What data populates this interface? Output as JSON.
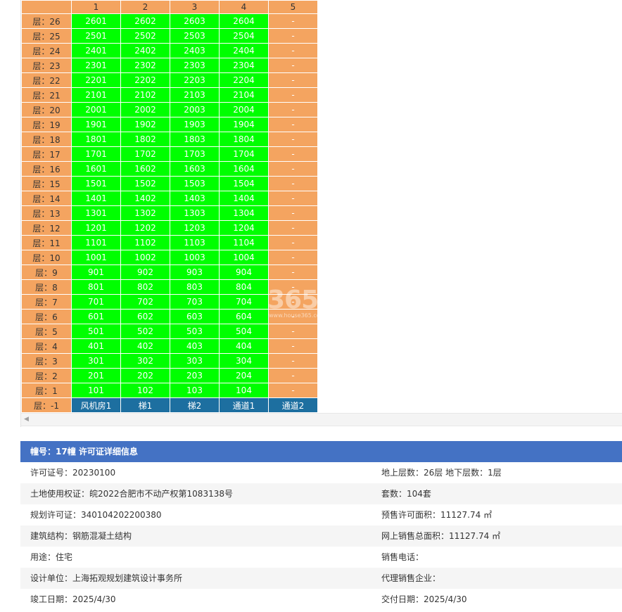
{
  "grid": {
    "columns": [
      "",
      "1",
      "2",
      "3",
      "4",
      "5"
    ],
    "rows": [
      {
        "floor": "层：26",
        "units": [
          "2601",
          "2602",
          "2603",
          "2604"
        ],
        "extra": "-"
      },
      {
        "floor": "层：25",
        "units": [
          "2501",
          "2502",
          "2503",
          "2504"
        ],
        "extra": "-"
      },
      {
        "floor": "层：24",
        "units": [
          "2401",
          "2402",
          "2403",
          "2404"
        ],
        "extra": "-"
      },
      {
        "floor": "层：23",
        "units": [
          "2301",
          "2302",
          "2303",
          "2304"
        ],
        "extra": "-"
      },
      {
        "floor": "层：22",
        "units": [
          "2201",
          "2202",
          "2203",
          "2204"
        ],
        "extra": "-"
      },
      {
        "floor": "层：21",
        "units": [
          "2101",
          "2102",
          "2103",
          "2104"
        ],
        "extra": "-"
      },
      {
        "floor": "层：20",
        "units": [
          "2001",
          "2002",
          "2003",
          "2004"
        ],
        "extra": "-"
      },
      {
        "floor": "层：19",
        "units": [
          "1901",
          "1902",
          "1903",
          "1904"
        ],
        "extra": "-"
      },
      {
        "floor": "层：18",
        "units": [
          "1801",
          "1802",
          "1803",
          "1804"
        ],
        "extra": "-"
      },
      {
        "floor": "层：17",
        "units": [
          "1701",
          "1702",
          "1703",
          "1704"
        ],
        "extra": "-"
      },
      {
        "floor": "层：16",
        "units": [
          "1601",
          "1602",
          "1603",
          "1604"
        ],
        "extra": "-"
      },
      {
        "floor": "层：15",
        "units": [
          "1501",
          "1502",
          "1503",
          "1504"
        ],
        "extra": "-"
      },
      {
        "floor": "层：14",
        "units": [
          "1401",
          "1402",
          "1403",
          "1404"
        ],
        "extra": "-"
      },
      {
        "floor": "层：13",
        "units": [
          "1301",
          "1302",
          "1303",
          "1304"
        ],
        "extra": "-"
      },
      {
        "floor": "层：12",
        "units": [
          "1201",
          "1202",
          "1203",
          "1204"
        ],
        "extra": "-"
      },
      {
        "floor": "层：11",
        "units": [
          "1101",
          "1102",
          "1103",
          "1104"
        ],
        "extra": "-"
      },
      {
        "floor": "层：10",
        "units": [
          "1001",
          "1002",
          "1003",
          "1004"
        ],
        "extra": "-"
      },
      {
        "floor": "层：9",
        "units": [
          "901",
          "902",
          "903",
          "904"
        ],
        "extra": "-"
      },
      {
        "floor": "层：8",
        "units": [
          "801",
          "802",
          "803",
          "804"
        ],
        "extra": "-"
      },
      {
        "floor": "层：7",
        "units": [
          "701",
          "702",
          "703",
          "704"
        ],
        "extra": "-"
      },
      {
        "floor": "层：6",
        "units": [
          "601",
          "602",
          "603",
          "604"
        ],
        "extra": "-"
      },
      {
        "floor": "层：5",
        "units": [
          "501",
          "502",
          "503",
          "504"
        ],
        "extra": "-"
      },
      {
        "floor": "层：4",
        "units": [
          "401",
          "402",
          "403",
          "404"
        ],
        "extra": "-"
      },
      {
        "floor": "层：3",
        "units": [
          "301",
          "302",
          "303",
          "304"
        ],
        "extra": "-"
      },
      {
        "floor": "层：2",
        "units": [
          "201",
          "202",
          "203",
          "204"
        ],
        "extra": "-"
      },
      {
        "floor": "层：1",
        "units": [
          "101",
          "102",
          "103",
          "104"
        ],
        "extra": "-"
      }
    ],
    "bottom_row": {
      "floor": "层：-1",
      "cells": [
        "风机房1",
        "梯1",
        "梯2",
        "通道1",
        "通道2"
      ]
    }
  },
  "watermark": {
    "number": "365",
    "url": "www.house365.co"
  },
  "detail": {
    "title": "幢号：17幢 许可证详细信息",
    "rows": [
      {
        "left": "许可证号：20230100",
        "right": "地上层数：26层  地下层数：1层"
      },
      {
        "left": "土地使用权证：皖2022合肥市不动产权第1083138号",
        "right": "套数：104套"
      },
      {
        "left": "规划许可证：340104202200380",
        "right": "预售许可面积：11127.74 ㎡"
      },
      {
        "left": "建筑结构：钢筋混凝土结构",
        "right": "网上销售总面积：11127.74 ㎡"
      },
      {
        "left": "用途：住宅",
        "right": "销售电话："
      },
      {
        "left": "设计单位：上海拓观规划建筑设计事务所",
        "right": "代理销售企业："
      },
      {
        "left": "竣工日期：2025/4/30",
        "right": "交付日期：2025/4/30"
      }
    ]
  },
  "colors": {
    "available_unit": "#00ff00",
    "floor_label": "#f4a460",
    "utility_room": "#1d6fa0",
    "detail_header": "#4472c4"
  }
}
